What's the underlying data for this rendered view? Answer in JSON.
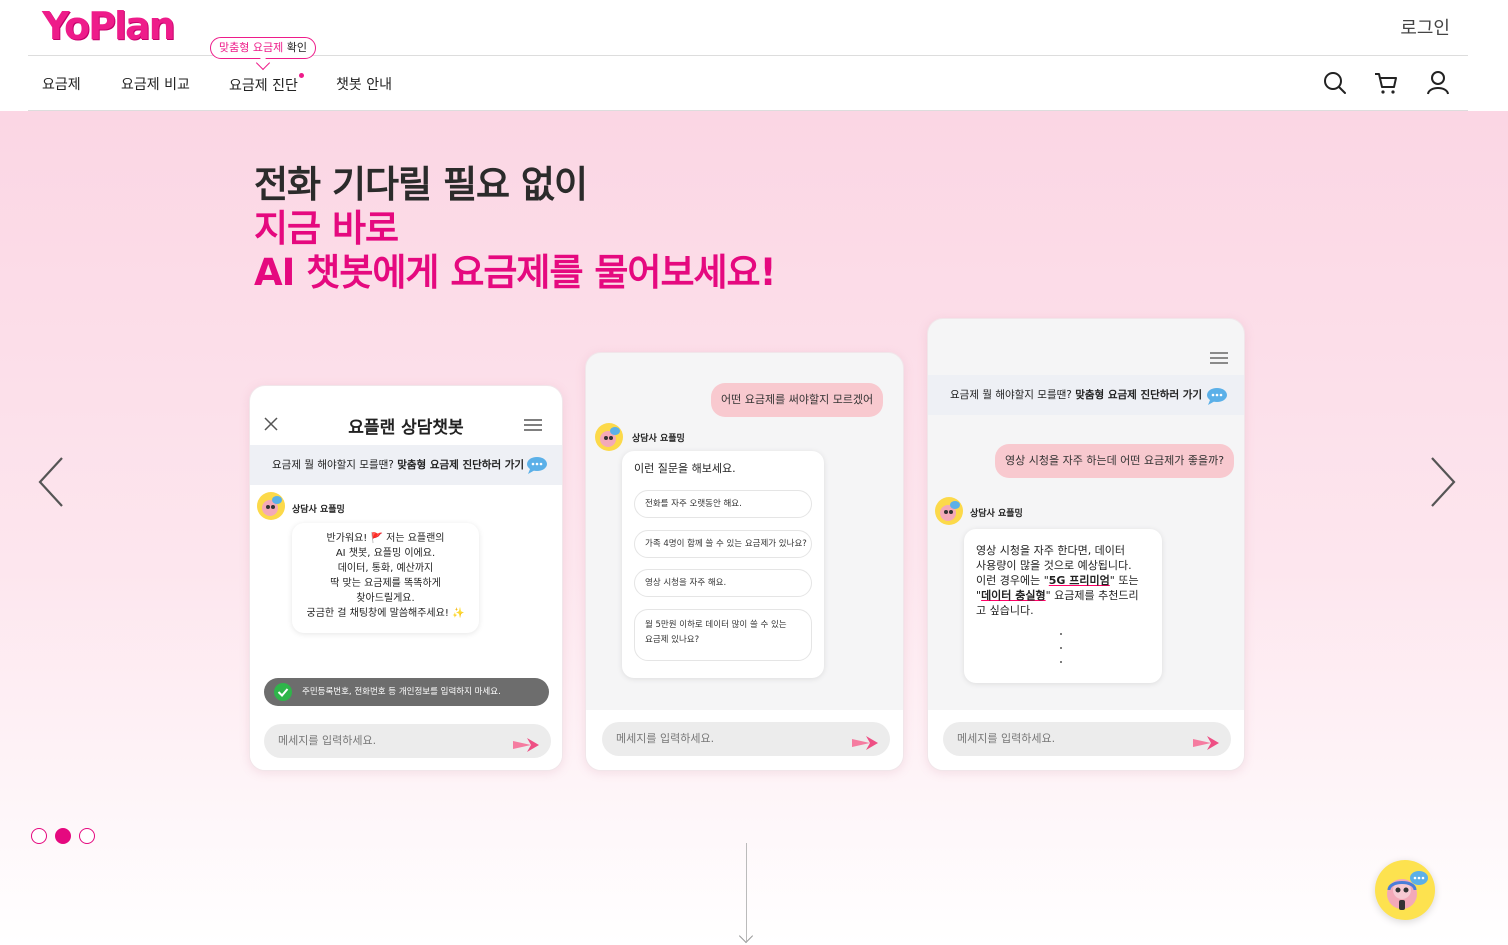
{
  "header": {
    "logo": "YoPlan",
    "login": "로그인",
    "nav": [
      {
        "label": "요금제"
      },
      {
        "label": "요금제 비교"
      },
      {
        "label": "요금제 진단"
      },
      {
        "label": "챗봇 안내"
      }
    ],
    "badge_highlight": "맞춤형 요금제",
    "badge_rest": " 확인"
  },
  "hero": {
    "line1": "전화 기다릴 필요 없이",
    "line2": "지금 바로",
    "line3": "AI 챗봇에게 요금제를 물어보세요!"
  },
  "phone1": {
    "title": "요플랜 상담챗봇",
    "banner_plain": "요금제 뭘 해야할지 모를땐? ",
    "banner_bold": "맞춤형 요금제 진단하러 가기",
    "agent": "상담사 요플밍",
    "greeting": [
      "반가워요! 🚩 저는 요플랜의",
      "AI 챗봇, 요플밍 이에요.",
      "데이터, 통화, 예산까지",
      "딱 맞는 요금제를 똑똑하게",
      "찾아드릴게요.",
      "궁금한 걸 채팅창에 말씀해주세요! ✨"
    ],
    "warning": "주민등록번호, 전화번호 등 개인정보를 입력하지 마세요.",
    "input_placeholder": "메세지를 입력하세요."
  },
  "phone2": {
    "user_message": "어떤 요금제를 써야할지 모르겠어",
    "agent": "상담사 요플밍",
    "prompt": "이런 질문을 해보세요.",
    "questions": [
      "전화를 자주 오랫동안 해요.",
      "가족 4명이 함께 쓸 수 있는 요금제가 있나요?",
      "영상 시청을 자주 해요.",
      "월 5만원 이하로 데이터 많이 쓸 수 있는",
      "요금제 있나요?"
    ],
    "input_placeholder": "메세지를 입력하세요."
  },
  "phone3": {
    "banner_plain": "요금제 뭘 해야할지 모를땐? ",
    "banner_bold": "맞춤형 요금제 진단하러 가기",
    "user_message": "영상 시청을 자주 하는데 어떤 요금제가 좋을까?",
    "agent": "상담사 요플밍",
    "answer_lines": [
      "영상 시청을 자주 한다면, 데이터",
      "사용량이 많을 것으로 예상됩니다.",
      "이런 경우에는 \"",
      "5G 프리미엄",
      "\" 또는",
      "\"",
      "데이터 충실형",
      "\" 요금제를 추천드리",
      "고 싶습니다."
    ],
    "input_placeholder": "메세지를 입력하세요."
  },
  "carousel": {
    "total": 3,
    "active": 2
  },
  "colors": {
    "brand": "#e5097f",
    "user_bubble": "#f8c9cf",
    "banner_bg": "#eef0f5"
  },
  "icons": [
    "search-icon",
    "cart-icon",
    "user-icon",
    "chevron-left-icon",
    "chevron-right-icon",
    "close-icon",
    "menu-icon",
    "chat-bubble-icon",
    "send-icon",
    "check-icon",
    "chatbot-avatar"
  ]
}
